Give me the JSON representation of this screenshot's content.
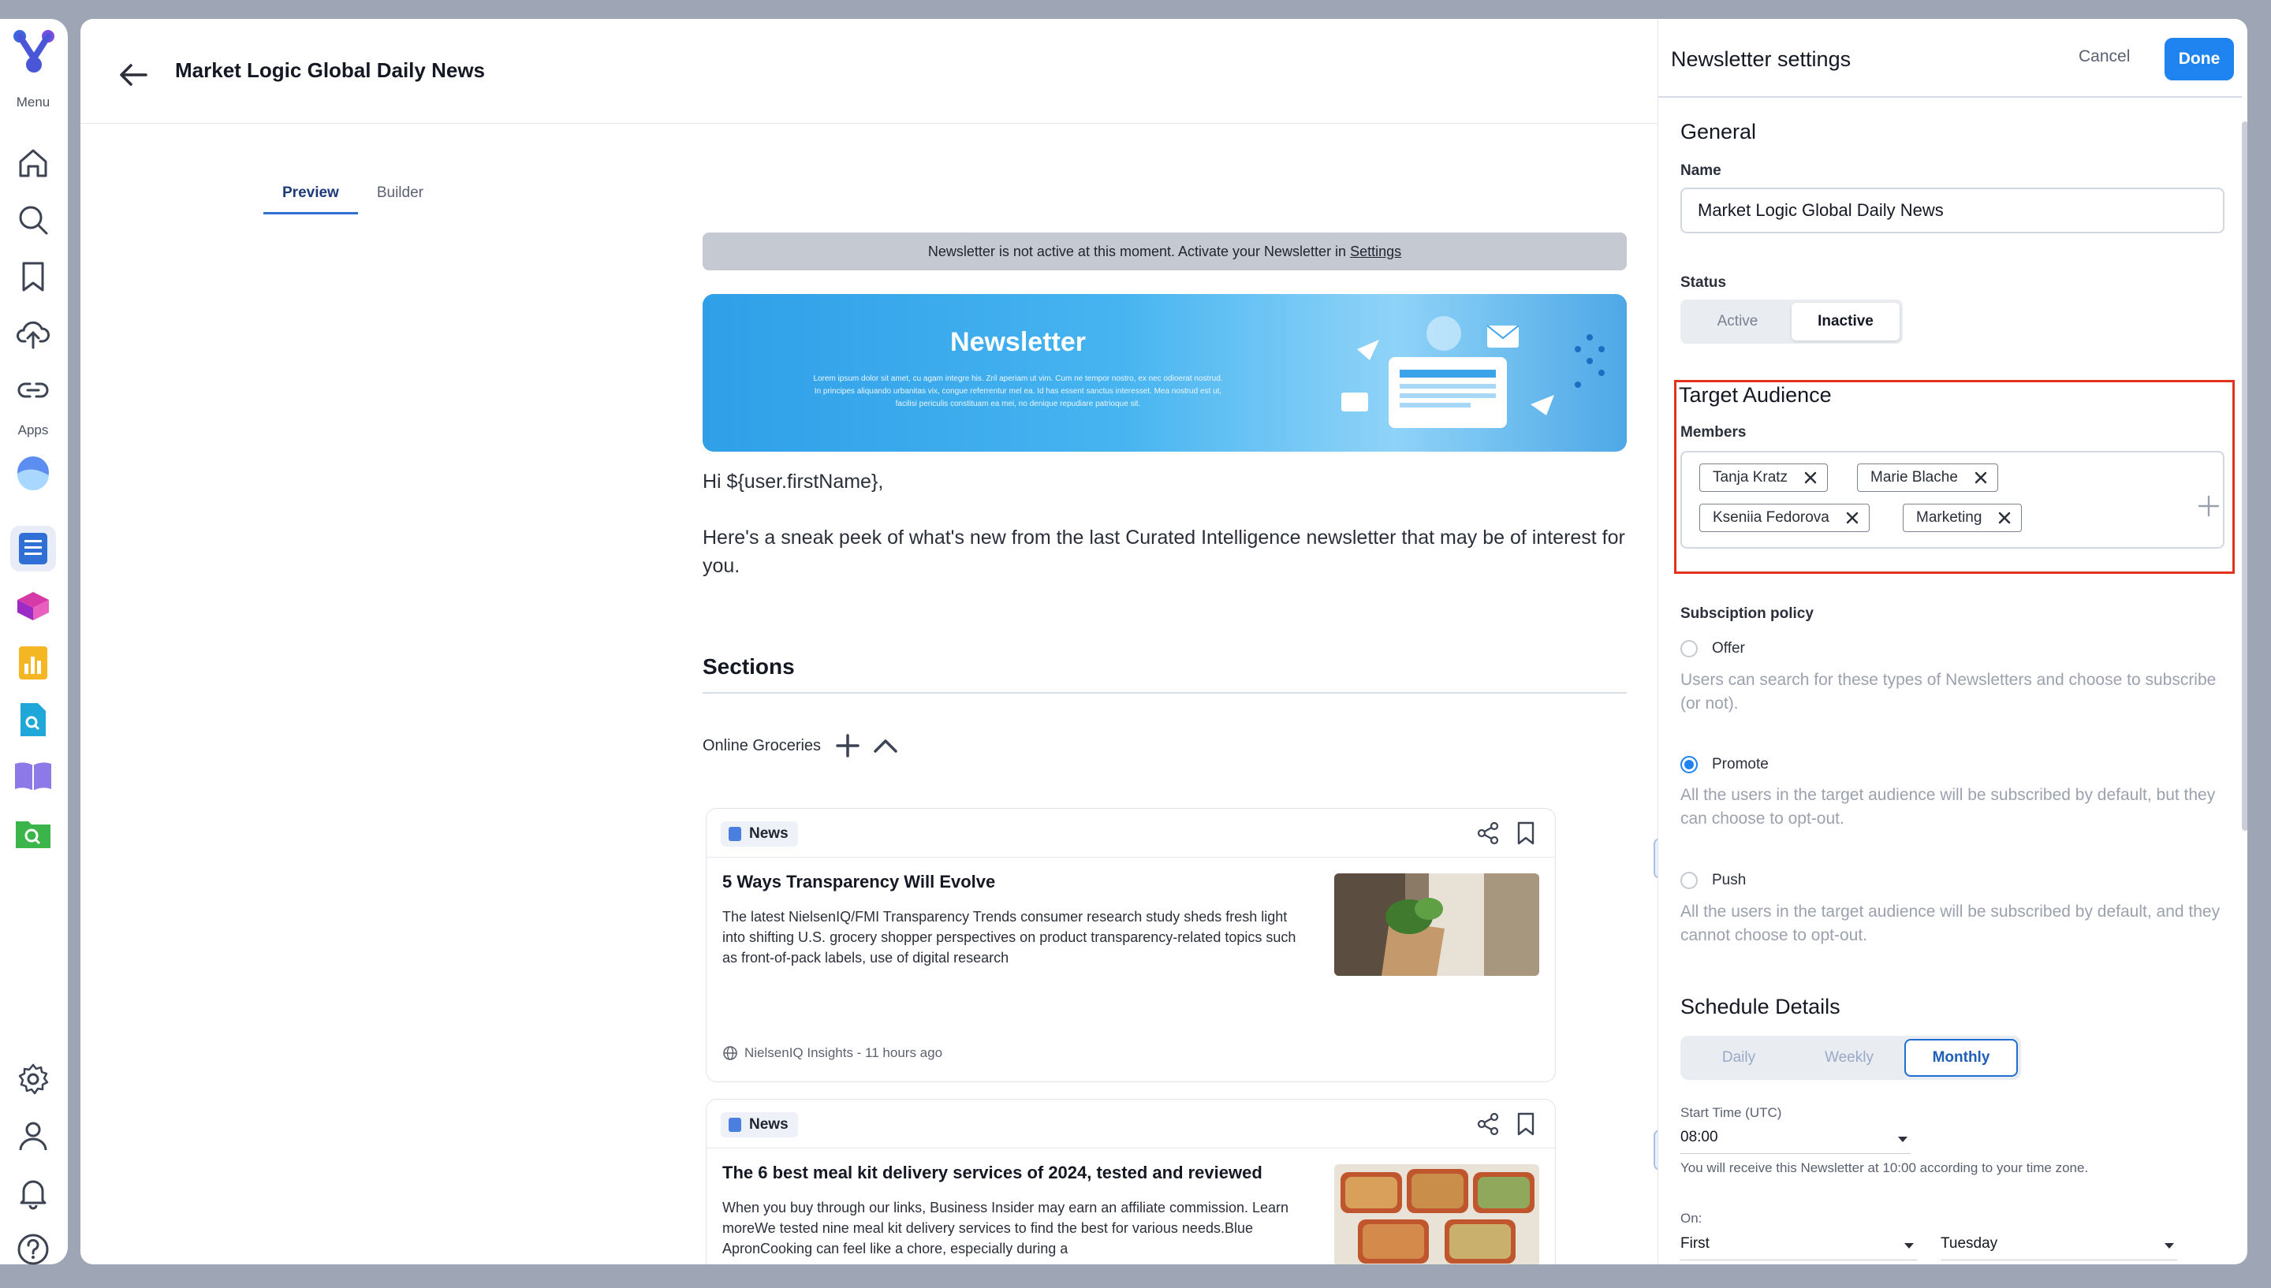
{
  "rail": {
    "menu_label": "Menu",
    "apps_label": "Apps",
    "nav_icons": [
      "home-icon",
      "search-icon",
      "bookmark-icon",
      "upload-cloud-icon",
      "link-icon"
    ],
    "app_icons": [
      "app-globe-icon",
      "app-newsletter-icon",
      "app-cube-icon",
      "app-chart-icon",
      "app-doc-search-icon",
      "app-book-icon",
      "app-folder-search-icon"
    ],
    "bottom_icons": [
      "settings-icon",
      "user-icon",
      "bell-icon",
      "help-icon"
    ]
  },
  "header": {
    "title": "Market Logic Global Daily News"
  },
  "tabs": [
    {
      "label": "Preview",
      "active": true
    },
    {
      "label": "Builder",
      "active": false
    }
  ],
  "preview": {
    "inactive_notice": "Newsletter is not active at this moment. Activate your Newsletter in ",
    "inactive_link": "Settings",
    "hero_title": "Newsletter",
    "hero_lorem": "Lorem ipsum dolor sit amet, cu agam integre his. Zril aperiam ut vim. Cum ne tempor nostro, ex nec odioerat nostrud. In principes aliquando urbanitas vix, congue referrentur mel ea. Id has essent sanctus interesset. Mea nostrud est ut, facilisi periculis constituam ea mei, no denique repudiare patrioque sit.",
    "greeting": "Hi ${user.firstName},",
    "intro": "Here's a sneak peek of what's new from the last Curated Intelligence newsletter that may be of interest for you.",
    "sections_title": "Sections",
    "section_name": "Online Groceries",
    "cards": [
      {
        "badge": "News",
        "title": "5 Ways Transparency Will Evolve",
        "text": "The latest NielsenIQ/FMI Transparency Trends consumer research study sheds fresh light into shifting U.S. grocery shopper perspectives on product transparency-related topics such as front-of-pack labels, use of digital research",
        "source": "NielsenIQ Insights - 11 hours ago"
      },
      {
        "badge": "News",
        "title": "The 6 best meal kit delivery services of 2024, tested and reviewed",
        "text": "When you buy through our links, Business Insider may earn an affiliate commission. Learn moreWe tested nine meal kit delivery services to find the best for various needs.Blue ApronCooking can feel like a chore, especially during a",
        "source": ""
      }
    ]
  },
  "settings": {
    "title": "Newsletter settings",
    "cancel_label": "Cancel",
    "done_label": "Done",
    "general_heading": "General",
    "name_label": "Name",
    "name_value": "Market Logic Global Daily News",
    "status_label": "Status",
    "status_options": [
      "Active",
      "Inactive"
    ],
    "status_selected": "Inactive",
    "target_heading": "Target Audience",
    "members_label": "Members",
    "members": [
      "Tanja Kratz",
      "Marie Blache",
      "Kseniia Fedorova",
      "Marketing"
    ],
    "policy_label": "Subsciption policy",
    "policies": [
      {
        "label": "Offer",
        "selected": false,
        "help": "Users can search for these types of Newsletters and choose to subscribe (or not)."
      },
      {
        "label": "Promote",
        "selected": true,
        "help": "All the users in the target audience will be subscribed by default, but they can choose to opt-out."
      },
      {
        "label": "Push",
        "selected": false,
        "help": "All the users in the target audience will be subscribed by default, and they cannot choose to opt-out."
      }
    ],
    "schedule_heading": "Schedule Details",
    "frequencies": [
      "Daily",
      "Weekly",
      "Monthly"
    ],
    "frequency_selected": "Monthly",
    "start_time_label": "Start Time (UTC)",
    "start_time_value": "08:00",
    "timezone_note": "You will receive this Newsletter at 10:00 according to your time zone.",
    "on_label": "On:",
    "on_ordinal": "First",
    "on_day": "Tuesday"
  },
  "colors": {
    "accent": "#1f84f0",
    "highlight_border": "#e0341e",
    "backdrop": "#9ea6b6"
  }
}
